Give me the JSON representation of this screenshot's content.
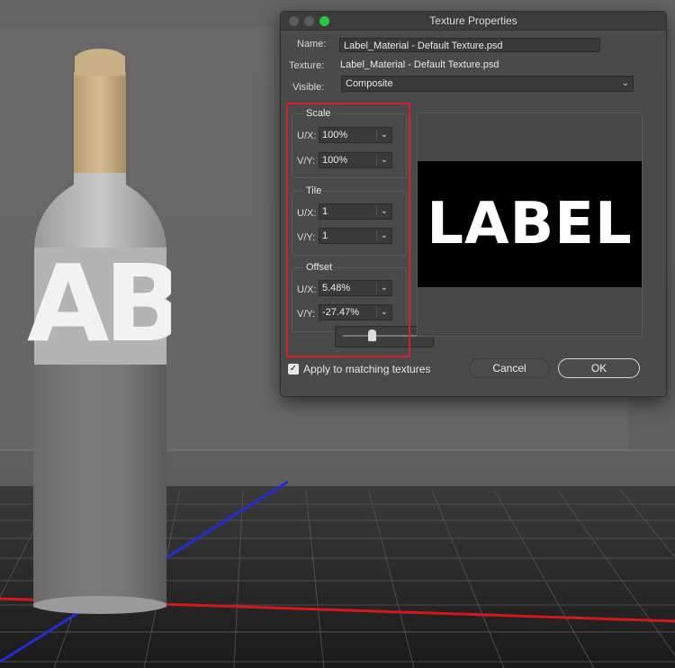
{
  "dialog": {
    "title": "Texture Properties",
    "name_label": "Name:",
    "name_value": "Label_Material - Default Texture.psd",
    "texture_label": "Texture:",
    "texture_value": "Label_Material - Default Texture.psd",
    "visible_label": "Visible:",
    "visible_value": "Composite",
    "scale": {
      "title": "Scale",
      "u_label": "U/X:",
      "u_value": "100%",
      "v_label": "V/Y:",
      "v_value": "100%"
    },
    "tile": {
      "title": "Tile",
      "u_label": "U/X:",
      "u_value": "1",
      "v_label": "V/Y:",
      "v_value": "1"
    },
    "offset": {
      "title": "Offset",
      "u_label": "U/X:",
      "u_value": "5.48%",
      "v_label": "V/Y:",
      "v_value": "-27.47%"
    },
    "preview_text": "LABEL",
    "apply_label": "Apply to matching textures",
    "apply_checked": true,
    "cancel_label": "Cancel",
    "ok_label": "OK"
  },
  "viewport": {
    "bottle_label_text": "ABE",
    "axis_colors": {
      "x": "#d11a1a",
      "z": "#1f2fd6"
    },
    "accent_highlight": "#d6212a"
  },
  "icons": [
    "chevron-down-icon",
    "checkmark-icon",
    "slider-thumb-icon"
  ]
}
